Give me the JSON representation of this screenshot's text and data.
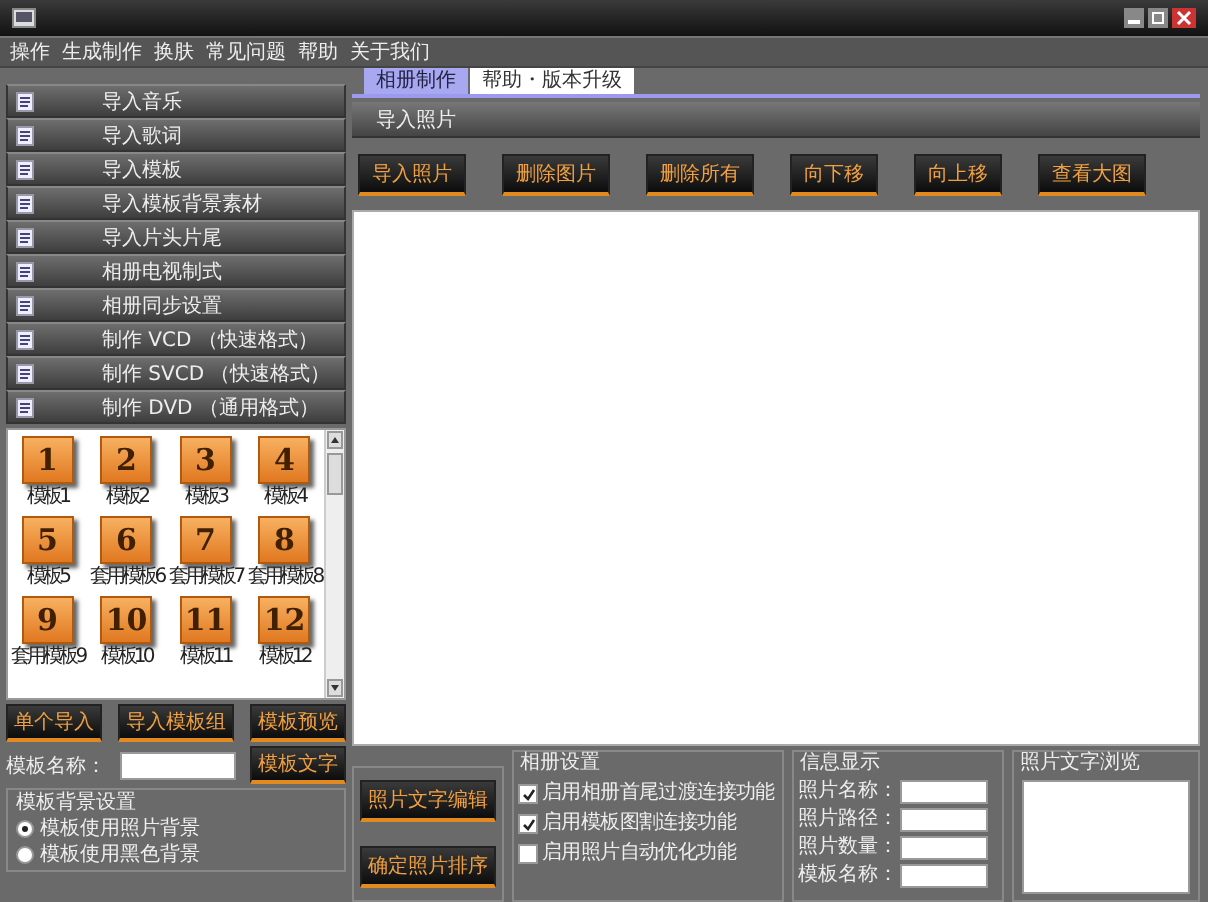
{
  "menu": [
    "操作",
    "生成制作",
    "换肤",
    "常见问题",
    "帮助",
    "关于我们"
  ],
  "sidebar": {
    "items": [
      "导入音乐",
      "导入歌词",
      "导入模板",
      "导入模板背景素材",
      "导入片头片尾",
      "相册电视制式",
      "相册同步设置",
      "制作 VCD （快速格式）",
      "制作 SVCD （快速格式）",
      "制作 DVD （通用格式）"
    ]
  },
  "templates": {
    "items": [
      {
        "number": "1",
        "label": "模板1"
      },
      {
        "number": "2",
        "label": "模板2"
      },
      {
        "number": "3",
        "label": "模板3"
      },
      {
        "number": "4",
        "label": "模板4"
      },
      {
        "number": "5",
        "label": "模板5"
      },
      {
        "number": "6",
        "label": "套用模板6"
      },
      {
        "number": "7",
        "label": "套用模板7"
      },
      {
        "number": "8",
        "label": "套用模板8"
      },
      {
        "number": "9",
        "label": "套用模板9"
      },
      {
        "number": "10",
        "label": "模板10"
      },
      {
        "number": "11",
        "label": "模板11"
      },
      {
        "number": "12",
        "label": "模板12"
      }
    ]
  },
  "template_buttons": [
    "单个导入",
    "导入模板组",
    "模板预览"
  ],
  "template_name": {
    "label": "模板名称：",
    "button": "模板文字"
  },
  "background_settings": {
    "title": "模板背景设置",
    "options": [
      {
        "label": "模板使用照片背景",
        "selected": true
      },
      {
        "label": "模板使用黑色背景",
        "selected": false
      }
    ]
  },
  "tabs": [
    {
      "label": "相册制作",
      "selected": true
    },
    {
      "label": "帮助・版本升级",
      "selected": false
    }
  ],
  "photo_panel": {
    "header": "导入照片",
    "buttons": [
      "导入照片",
      "删除图片",
      "删除所有",
      "向下移",
      "向上移",
      "查看大图"
    ]
  },
  "photo_actions": [
    "照片文字编辑",
    "确定照片排序"
  ],
  "album_settings": {
    "title": "相册设置",
    "options": [
      {
        "label": "启用相册首尾过渡连接功能",
        "checked": true
      },
      {
        "label": "启用模板图割连接功能",
        "checked": true
      },
      {
        "label": "启用照片自动优化功能",
        "checked": false
      }
    ]
  },
  "info": {
    "title": "信息显示",
    "fields": [
      "照片名称：",
      "照片路径：",
      "照片数量：",
      "模板名称："
    ]
  },
  "preview": {
    "title": "照片文字浏览"
  }
}
